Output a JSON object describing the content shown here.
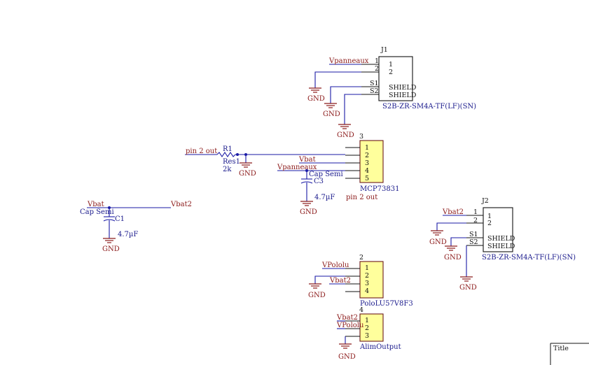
{
  "connectors": {
    "j1": {
      "designator": "J1",
      "pins": [
        "1",
        "2",
        "S1",
        "S2"
      ],
      "inner": [
        "1",
        "2",
        "SHIELD",
        "SHIELD"
      ],
      "part": "S2B-ZR-SM4A-TF(LF)(SN)"
    },
    "j2": {
      "designator": "J2",
      "pins": [
        "1",
        "2",
        "S1",
        "S2"
      ],
      "inner": [
        "1",
        "2",
        "SHIELD",
        "SHIELD"
      ],
      "part": "S2B-ZR-SM4A-TF(LF)(SN)"
    }
  },
  "mcp": {
    "designator": "3",
    "pins": [
      "1",
      "2",
      "3",
      "4",
      "5"
    ],
    "part": "MCP73831"
  },
  "pololu": {
    "designator": "2",
    "pins": [
      "1",
      "2",
      "3",
      "4"
    ],
    "part": "PoloLU57V8F3"
  },
  "alim": {
    "designator": "4",
    "pins": [
      "1",
      "2",
      "3"
    ],
    "part": "AlimOutput"
  },
  "r1": {
    "designator": "R1",
    "type": "Res1",
    "value": "2k"
  },
  "c1": {
    "designator": "C1",
    "type": "Cap Semi",
    "value": "4.7µF"
  },
  "c3": {
    "designator": "C3",
    "type": "Cap Semi",
    "value": "4.7µF"
  },
  "nets": {
    "vpanneaux": "Vpanneaux",
    "vbat": "Vbat",
    "vbat2": "Vbat2",
    "vpololu": "VPololu",
    "gnd": "GND",
    "pin2out": "pin 2 out"
  },
  "title_block": {
    "label": "Title"
  }
}
